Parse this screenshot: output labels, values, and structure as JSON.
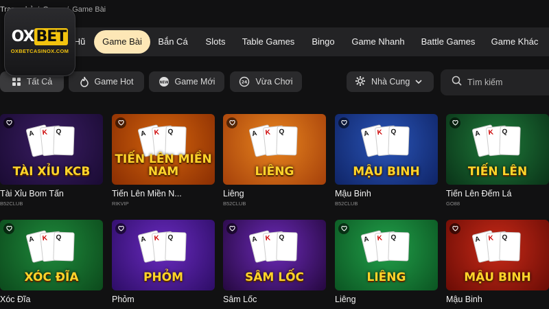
{
  "breadcrumb": {
    "home": "Trang chủ",
    "section": "Game",
    "current": "Game Bài"
  },
  "logo": {
    "left": "OX",
    "right": "BET",
    "site": "OXBETCASINOX.COM"
  },
  "categories": [
    {
      "label": "Nổ Hũ"
    },
    {
      "label": "Game Bài",
      "active": true
    },
    {
      "label": "Bắn Cá"
    },
    {
      "label": "Slots"
    },
    {
      "label": "Table Games"
    },
    {
      "label": "Bingo"
    },
    {
      "label": "Game Nhanh"
    },
    {
      "label": "Battle Games"
    },
    {
      "label": "Game Khác"
    }
  ],
  "filters": [
    {
      "label": "Tất Cả",
      "icon": "grid-icon",
      "active": true
    },
    {
      "label": "Game Hot",
      "icon": "flame-icon"
    },
    {
      "label": "Game Mới",
      "icon": "new-badge-icon"
    },
    {
      "label": "Vừa Chơi",
      "icon": "clock-24-icon"
    }
  ],
  "provider_select": {
    "label": "Nhà Cung Cấp",
    "icon": "gear-icon"
  },
  "search": {
    "placeholder": "Tìm kiếm"
  },
  "games": [
    {
      "name": "Tài Xỉu Bom Tấn",
      "provider": "B52CLUB",
      "art_title": "TÀI XỈU KCB",
      "bg": "#3a1d63",
      "bg2": "#1a0b33"
    },
    {
      "name": "Tiến Lên Miền N...",
      "provider": "RIKVIP",
      "art_title": "TIẾN LÊN MIỀN NAM",
      "bg": "#d4640c",
      "bg2": "#8a2e03"
    },
    {
      "name": "Liêng",
      "provider": "B52CLUB",
      "art_title": "LIÊNG",
      "bg": "#e8851f",
      "bg2": "#a5400a"
    },
    {
      "name": "Mậu Binh",
      "provider": "B52CLUB",
      "art_title": "MẬU BINH",
      "bg": "#2a55b8",
      "bg2": "#0f2466"
    },
    {
      "name": "Tiến Lên Đếm Lá",
      "provider": "GO88",
      "art_title": "TIẾN LÊN",
      "bg": "#1f7a3a",
      "bg2": "#0a3318"
    },
    {
      "name": "Xóc Đĩa",
      "provider": "",
      "art_title": "XÓC ĐĨA",
      "bg": "#1f8a3c",
      "bg2": "#0c4a1c"
    },
    {
      "name": "Phỏm",
      "provider": "",
      "art_title": "PHỎM",
      "bg": "#6a2bc0",
      "bg2": "#2d0d66"
    },
    {
      "name": "Sâm Lốc",
      "provider": "",
      "art_title": "SÂM LỐC",
      "bg": "#6c2ab8",
      "bg2": "#25083f"
    },
    {
      "name": "Liêng",
      "provider": "",
      "art_title": "LIÊNG",
      "bg": "#22a04a",
      "bg2": "#0b5522"
    },
    {
      "name": "Mậu Binh",
      "provider": "",
      "art_title": "MẬU BINH",
      "bg": "#c82a18",
      "bg2": "#6a0c05"
    }
  ]
}
